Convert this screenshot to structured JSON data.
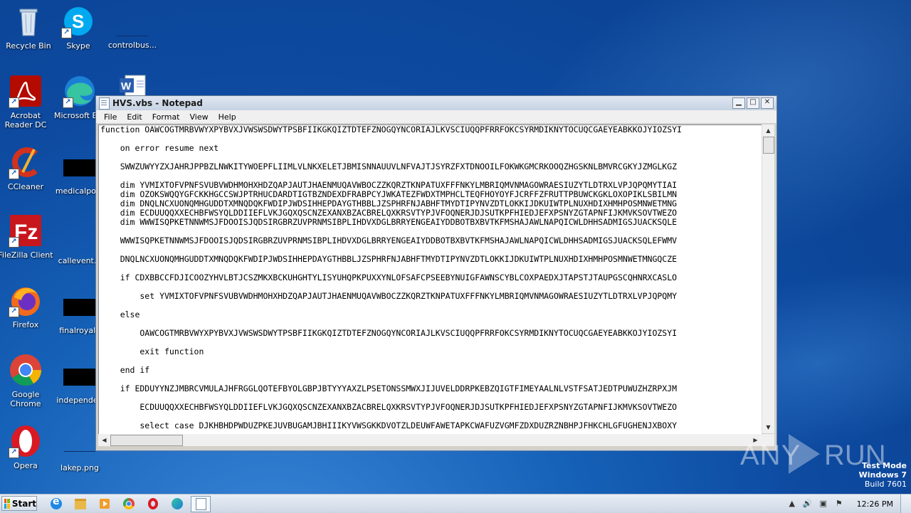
{
  "desktop": {
    "icons": [
      {
        "label": "Recycle Bin",
        "icon": "recycle-bin-icon"
      },
      {
        "label": "Skype",
        "icon": "skype-icon"
      },
      {
        "label": "controlbus...",
        "icon": "blank-file-icon"
      },
      {
        "label": "Acrobat Reader DC",
        "icon": "acrobat-icon"
      },
      {
        "label": "Microsoft Ec",
        "icon": "edge-icon"
      },
      {
        "label": "",
        "icon": "word-doc-icon"
      },
      {
        "label": "CCleaner",
        "icon": "ccleaner-icon"
      },
      {
        "label": "medicalpoor",
        "icon": "redacted-file-icon"
      },
      {
        "label": "FileZilla Client",
        "icon": "filezilla-icon"
      },
      {
        "label": "callevent.p",
        "icon": "redacted-file-icon"
      },
      {
        "label": "Firefox",
        "icon": "firefox-icon"
      },
      {
        "label": "finalroyal.j",
        "icon": "redacted-file-icon"
      },
      {
        "label": "Google Chrome",
        "icon": "chrome-icon"
      },
      {
        "label": "independen",
        "icon": "redacted-file-icon"
      },
      {
        "label": "Opera",
        "icon": "opera-icon"
      },
      {
        "label": "lakep.png",
        "icon": "image-file-icon"
      }
    ]
  },
  "notepad": {
    "title": "HVS.vbs - Notepad",
    "menu": [
      "File",
      "Edit",
      "Format",
      "View",
      "Help"
    ],
    "lines": [
      "function OAWCOGTMRBVWYXPYBVXJVWSWSDWYTPSBFIIKGKQIZTDTEFZNOGQYNCORIAJLKVSCIUQQPFRRFOKCSYRMDIKNYTOCUQCGAEYEABKKOJYIOZSYI",
      "",
      "    on error resume next",
      "",
      "    SWWZUWYYZXJAHRJPPBZLNWKITYWOEPFLIIMLVLNKXELETJBMISNNAUUVLNFVAJTJSYRZFXTDNOOILFOKWKGMCRKOOQZHGSKNLBMVRCGKYJZMGLKGZ",
      "",
      "    dim YVMIXTOFVPNFSVUBVWDHMOHXHDZQAPJAUTJHAENMUQAVWBOCZZKQRZTKNPATUXFFFNKYLMBRIQMVNMAGOWRAESIUZYTLDTRXLVPJQPQMYTIAI",
      "    dim OZOKSWQQYGFCKKHGCCSWJPTRHUCDARDTIGTBZNDEXDFRABPCYJWKATEZFWDXTMPHCLTEQFHOYOYFJCRFFZFRUTTPBUWCKGKLOXOPIKLSBILMN",
      "    dim DNQLNCXUONQMHGUDDTXMNQDQKFWDIPJWDSIHHEPDAYGTHBBLJZSPHRFNJABHFTMYDTIPYNVZDTLOKKIJDKUIWTPLNUXHDIXHMHPOSMNWETMNG",
      "    dim ECDUUQQXXECHBFWSYQLDDIIEFLVKJGQXQSCNZEXANXBZACBRELQXKRSVTYPJVFOQNERJDJSUTKPFHIEDJEFXPSNYZGTAPNFIJKMVKSOVTWEZO",
      "    dim WWWISQPKETNNWMSJFDOOISJQDSIRGBRZUVPRNMSIBPLIHDVXDGLBRRYENGEAIYDDBOTBXBVTKFMSHAJAWLNAPQICWLDHHSADMIGSJUACKSQLE",
      "",
      "    WWWISQPKETNNWMSJFDOOISJQDSIRGBRZUVPRNMSIBPLIHDVXDGLBRRYENGEAIYDDBOTBXBVTKFMSHAJAWLNAPQICWLDHHSADMIGSJUACKSQLEFWMV",
      "",
      "    DNQLNCXUONQMHGUDDTXMNQDQKFWDIPJWDSIHHEPDAYGTHBBLJZSPHRFNJABHFTMYDTIPYNVZDTLOKKIJDKUIWTPLNUXHDIXHMHPOSMNWETMNGQCZE",
      "",
      "    if CDXBBCCFDJICOOZYHVLBTJCSZMKXBCKUHGHTYLISYUHQPKPUXXYNLOFSAFCPSEEBYNUIGFAWNSCYBLCOXPAEDXJTAPSTJTAUPGSCQHNRXCASLO",
      "",
      "        set YVMIXTOFVPNFSVUBVWDHMOHXHDZQAPJAUTJHAENMUQAVWBOCZZKQRZTKNPATUXFFFNKYLMBRIQMVNMAGOWRAESIUZYTLDTRXLVPJQPQMY",
      "",
      "    else",
      "",
      "        OAWCOGTMRBVWYXPYBVXJVWSWSDWYTPSBFIIKGKQIZTDTEFZNOGQYNCORIAJLKVSCIUQQPFRRFOKCSYRMDIKNYTOCUQCGAEYEABKKOJYIOZSYI",
      "",
      "        exit function",
      "",
      "    end if",
      "",
      "    if EDDUYYNZJMBRCVMULAJHFRGGLQOTEFBYOLGBPJBTYYYAXZLPSETONSSMWXJIJUVELDDRPKEBZQIGTFIMEYAALNLVSTFSATJEDTPUWUZHZRPXJM",
      "",
      "        ECDUUQQXXECHBFWSYQLDDIIEFLVKJGQXQSCNZEXANXBZACBRELQXKRSVTYPJVFOQNERJDJSUTKPFHIEDJEFXPSNYZGTAPNFIJKMVKSOVTWEZO",
      "",
      "        select case DJKHBHDPWDUZPKEJUVBUGAMJBHIIIKYVWSGKKDVOTZLDEUWFAWETAPKCWAFUZVGMFZDXDUZRZNBHPJFHKCHLGFUGHENJXBOXY"
    ]
  },
  "watermark": {
    "left": "ANY",
    "right": "RUN"
  },
  "testmode": {
    "line1": "Test Mode",
    "line2": "Windows 7",
    "line3": "Build 7601"
  },
  "taskbar": {
    "start_label": "Start",
    "apps": [
      "ie-icon",
      "explorer-icon",
      "media-player-icon",
      "chrome-icon",
      "opera-icon",
      "edge-icon",
      "notepad-icon"
    ],
    "clock": "12:26 PM"
  }
}
